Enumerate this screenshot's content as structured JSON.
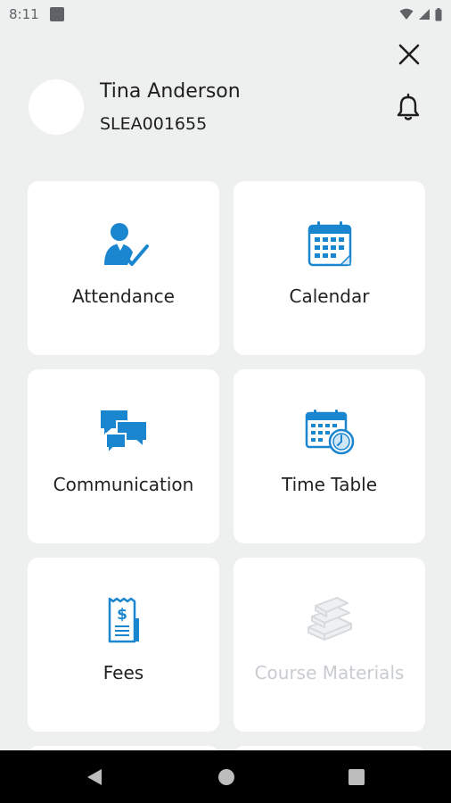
{
  "status_bar": {
    "time": "8:11",
    "icons": [
      "notification-icon",
      "wifi-icon",
      "signal-icon",
      "battery-icon"
    ]
  },
  "header": {
    "user_name": "Tina Anderson",
    "user_id": "SLEA001655",
    "close_icon": "close-icon",
    "bell_icon": "bell-icon"
  },
  "menu": {
    "attendance": {
      "label": "Attendance",
      "icon": "attendance-icon",
      "enabled": true
    },
    "calendar": {
      "label": "Calendar",
      "icon": "calendar-icon",
      "enabled": true
    },
    "communication": {
      "label": "Communication",
      "icon": "chat-bubbles-icon",
      "enabled": true
    },
    "timetable": {
      "label": "Time Table",
      "icon": "timetable-icon",
      "enabled": true
    },
    "fees": {
      "label": "Fees",
      "icon": "receipt-icon",
      "enabled": true
    },
    "course_materials": {
      "label": "Course Materials",
      "icon": "books-icon",
      "enabled": false
    }
  },
  "nav_bar": {
    "back_icon": "back-icon",
    "home_icon": "home-icon",
    "recents_icon": "recents-icon"
  },
  "colors": {
    "background": "#eeefef",
    "tile": "#ffffff",
    "accent_blue": "#1a86d0",
    "disabled": "#c8ccd0"
  }
}
